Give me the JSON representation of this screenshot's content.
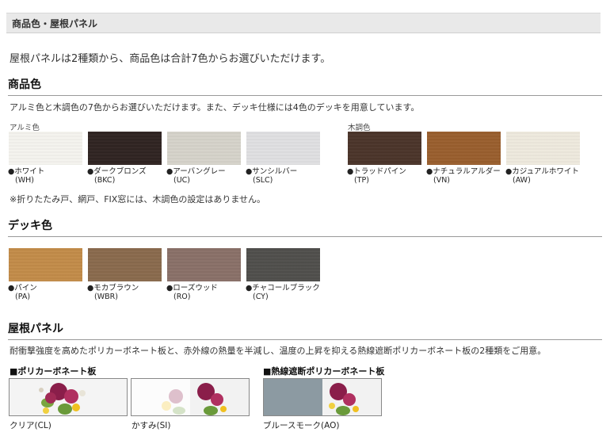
{
  "header": {
    "title": "商品色・屋根パネル"
  },
  "intro": "屋根パネルは2種類から、商品色は合計7色からお選びいただけます。",
  "product_color": {
    "title": "商品色",
    "description": "アルミ色と木調色の7色からお選びいただけます。また、デッキ仕様には4色のデッキを用意しています。",
    "aluminum": {
      "label": "アルミ色",
      "items": [
        {
          "name": "●ホワイト",
          "code": "(WH)",
          "color": "#f7f6f1"
        },
        {
          "name": "●ダークブロンズ",
          "code": "(BKC)",
          "color": "#2e2220"
        },
        {
          "name": "●アーバングレー",
          "code": "(UC)",
          "color": "#d8d5cc"
        },
        {
          "name": "●サンシルバー",
          "code": "(SLC)",
          "color": "#e2e2e4"
        }
      ]
    },
    "wood": {
      "label": "木調色",
      "items": [
        {
          "name": "●トラッドパイン",
          "code": "(TP)",
          "color": "#4a3328"
        },
        {
          "name": "●ナチュラルアルダー",
          "code": "(VN)",
          "color": "#9a5e2c"
        },
        {
          "name": "●カジュアルホワイト",
          "code": "(AW)",
          "color": "#f1ece0"
        }
      ]
    },
    "note": "※折りたたみ戸、網戸、FIX窓には、木調色の設定はありません。"
  },
  "deck_color": {
    "title": "デッキ色",
    "items": [
      {
        "name": "●パイン",
        "code": "(PA)",
        "color": "#c48c48"
      },
      {
        "name": "●モカブラウン",
        "code": "(WBR)",
        "color": "#8a6a4c"
      },
      {
        "name": "●ローズウッド",
        "code": "(RO)",
        "color": "#8a7068"
      },
      {
        "name": "●チャコールブラック",
        "code": "(CY)",
        "color": "#4f4e4b"
      }
    ]
  },
  "roof_panel": {
    "title": "屋根パネル",
    "description": "耐衝撃強度を高めたポリカーボネート板と、赤外線の熱量を半減し、温度の上昇を抑える熱線遮断ポリカーボネート板の2種類をご用意。",
    "polycarbonate": {
      "heading": "■ポリカーボネート板",
      "items": [
        {
          "label": "クリア(CL)"
        },
        {
          "label": "かすみ(SI)"
        }
      ]
    },
    "heat_block": {
      "heading": "■熱線遮断ポリカーボネート板",
      "items": [
        {
          "label": "ブルースモーク(AO)"
        }
      ]
    }
  }
}
